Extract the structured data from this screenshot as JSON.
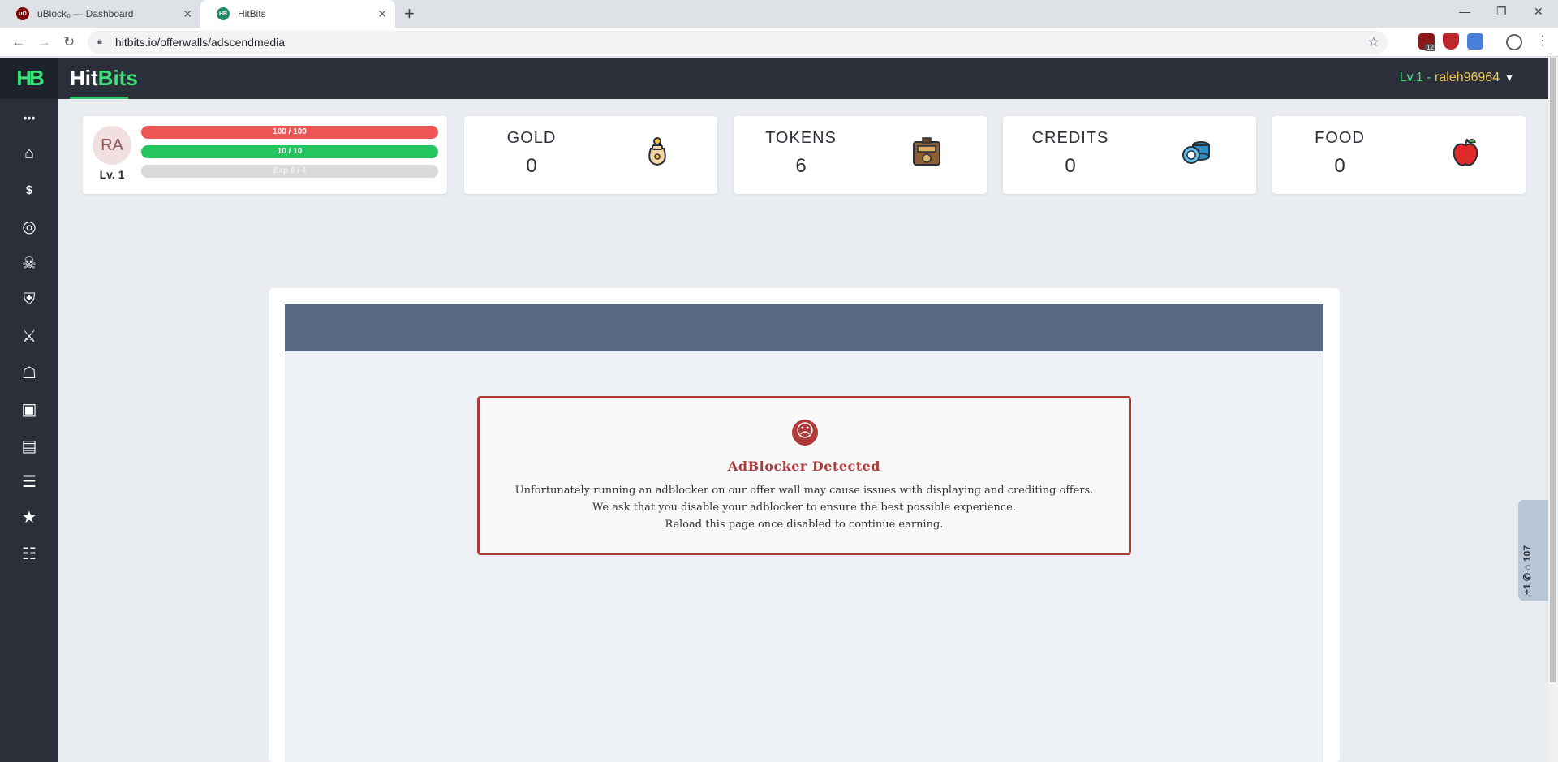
{
  "browser": {
    "tabs": [
      {
        "title": "uBlock₀ — Dashboard",
        "favicon": "ublock-icon"
      },
      {
        "title": "HitBits",
        "favicon": "hitbits-icon"
      }
    ],
    "new_tab": "+",
    "url": "hitbits.io/offerwalls/adscendmedia",
    "extension_badge": "12"
  },
  "site": {
    "logo_text": "HB",
    "brand_left": "Hit",
    "brand_right": "Bits",
    "user_level": "Lv.1",
    "user_sep": " - ",
    "username": "raleh96964"
  },
  "sidebar": {
    "items": [
      {
        "name": "more",
        "icon": "•••"
      },
      {
        "name": "home",
        "icon": "⌂"
      },
      {
        "name": "earn",
        "icon": "$"
      },
      {
        "name": "offers",
        "icon": "◎"
      },
      {
        "name": "battle",
        "icon": "☠"
      },
      {
        "name": "guard",
        "icon": "⛨"
      },
      {
        "name": "arena",
        "icon": "⚔"
      },
      {
        "name": "shop",
        "icon": "☖"
      },
      {
        "name": "inventory",
        "icon": "▣"
      },
      {
        "name": "cash",
        "icon": "▤"
      },
      {
        "name": "news",
        "icon": "☰"
      },
      {
        "name": "favorites",
        "icon": "★"
      },
      {
        "name": "tasks",
        "icon": "☷"
      }
    ]
  },
  "profile": {
    "avatar": "RA",
    "level": "Lv. 1",
    "hp": {
      "label": "100 / 100",
      "fraction": 1.0
    },
    "energy": {
      "label": "10 / 10",
      "fraction": 1.0
    },
    "exp": {
      "label": "Exp 0 / 4",
      "fraction": 0.0
    }
  },
  "stats": {
    "gold": {
      "label": "GOLD",
      "value": "0"
    },
    "tokens": {
      "label": "TOKENS",
      "value": "6"
    },
    "credits": {
      "label": "CREDITS",
      "value": "0"
    },
    "food": {
      "label": "FOOD",
      "value": "0"
    }
  },
  "alert": {
    "icon": "☹",
    "title": "AdBlocker Detected",
    "line1": "Unfortunately running an adblocker on our offer wall may cause issues with displaying and crediting offers.",
    "line2": "We ask that you disable your adblocker to ensure the best possible experience.",
    "line3": "Reload this page once disabled to continue earning."
  },
  "chat": {
    "text": "+1 ✆ ⌂ 107"
  },
  "colors": {
    "brand_green": "#3ee27a",
    "nav_bg": "#2a2f3a",
    "alert_red": "#b03a3a",
    "hp_red": "#f05555",
    "energy_green": "#22c55e",
    "username_gold": "#f0c850"
  }
}
